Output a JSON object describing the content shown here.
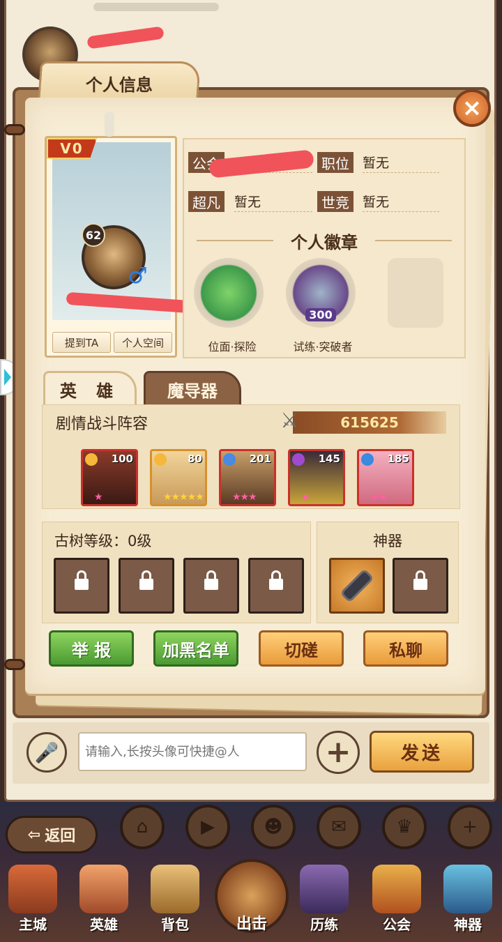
{
  "panel": {
    "title": "个人信息",
    "close_label": "×"
  },
  "profile": {
    "vip": "V0",
    "level": "62",
    "gender_icon": "♂",
    "mention_button": "提到TA",
    "space_button": "个人空间"
  },
  "info": {
    "guild_label": "公会",
    "position_label": "职位",
    "position_value": "暂无",
    "chaofan_label": "超凡",
    "chaofan_value": "暂无",
    "shijing_label": "世竞",
    "shijing_value": "暂无"
  },
  "badges": {
    "title": "个人徽章",
    "items": [
      {
        "label": "位面·探险",
        "color": "#3e9a4a"
      },
      {
        "label": "试练·突破者",
        "color": "#6a4a8a",
        "number": "300"
      }
    ]
  },
  "tabs": {
    "hero": "英 雄",
    "mage": "魔导器"
  },
  "lineup": {
    "title": "剧情战斗阵容",
    "power": "615625",
    "heroes": [
      {
        "level": "100",
        "stars": "★",
        "elem_color": "#f5b83a"
      },
      {
        "level": "80",
        "stars": "★★★★★",
        "elem_color": "#f5b83a"
      },
      {
        "level": "201",
        "stars": "★★★",
        "elem_color": "#4a8ae0"
      },
      {
        "level": "145",
        "stars": "★",
        "elem_color": "#a04ad0"
      },
      {
        "level": "185",
        "stars": "★★",
        "elem_color": "#3a8ae0"
      }
    ]
  },
  "tree": {
    "title": "古树等级：0级"
  },
  "artifact": {
    "title": "神器"
  },
  "actions": {
    "report": "举 报",
    "blacklist": "加黑名单",
    "duel": "切磋",
    "chat": "私聊"
  },
  "chat": {
    "placeholder": "请输入,长按头像可快捷@人",
    "send": "发送"
  },
  "bottom": {
    "back": "返回",
    "nav": [
      "主城",
      "英雄",
      "背包",
      "出击",
      "历练",
      "公会",
      "神器"
    ]
  },
  "colors": {
    "accent_brown": "#7c5236",
    "paper": "#f7ecd5",
    "green_button": "#4a9a32",
    "orange_button": "#e99a3a"
  }
}
